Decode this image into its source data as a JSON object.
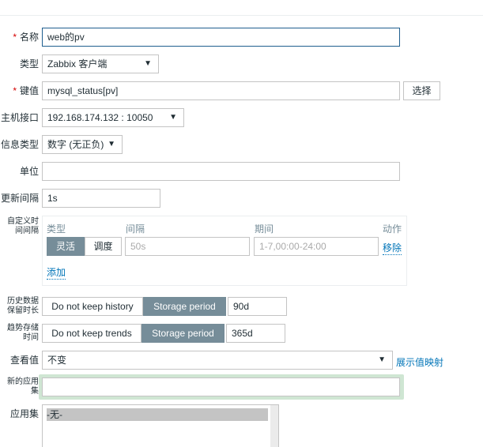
{
  "form": {
    "name": {
      "label": "名称",
      "value": "web的pv"
    },
    "type": {
      "label": "类型",
      "value": "Zabbix 客户端"
    },
    "key": {
      "label": "键值",
      "value": "mysql_status[pv]",
      "select": "选择"
    },
    "interface": {
      "label": "主机接口",
      "value": "192.168.174.132 : 10050"
    },
    "info_type": {
      "label": "信息类型",
      "value": "数字 (无正负)"
    },
    "units": {
      "label": "单位",
      "value": ""
    },
    "update": {
      "label": "更新间隔",
      "value": "1s"
    },
    "custom": {
      "label": "自定义时间间隔",
      "headers": [
        "类型",
        "间隔",
        "期间",
        "动作"
      ],
      "flexible": "灵活",
      "scheduling": "调度",
      "interval_placeholder": "50s",
      "period_placeholder": "1-7,00:00-24:00",
      "remove": "移除",
      "add": "添加"
    },
    "history": {
      "label": "历史数据保留时长",
      "off": "Do not keep history",
      "on": "Storage period",
      "value": "90d"
    },
    "trends": {
      "label": "趋势存储时间",
      "off": "Do not keep trends",
      "on": "Storage period",
      "value": "365d"
    },
    "valuemap": {
      "label": "查看值",
      "value": "不变",
      "link": "展示值映射"
    },
    "new_app": {
      "label": "新的应用集",
      "value": ""
    },
    "apps": {
      "label": "应用集",
      "items": [
        "-无-"
      ]
    }
  },
  "colors": {
    "accent": "#768d99",
    "link": "#0275b8",
    "required": "#d40000"
  }
}
